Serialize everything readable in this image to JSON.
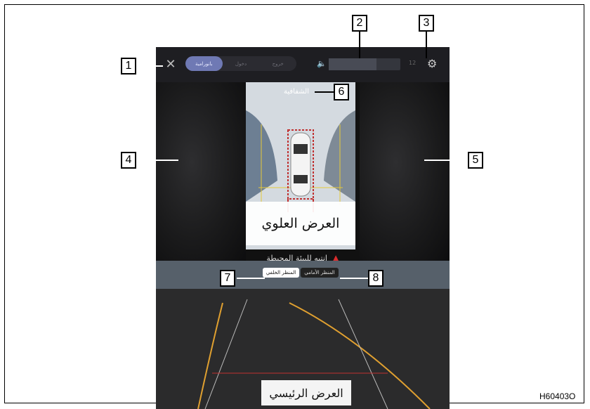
{
  "top_bar": {
    "close_icon": "close-icon",
    "view_tabs": [
      {
        "label": "بانورامية",
        "active": true
      },
      {
        "label": "دخول",
        "active": false
      },
      {
        "label": "خروج",
        "active": false
      }
    ],
    "mute_icon": "speaker-mute-icon",
    "volume_value": "12",
    "volume_fill_fraction": 0.67,
    "settings_icon": "gear-icon"
  },
  "panorama": {
    "transparency_label": "الشفافية",
    "top_view_label": "العرض العلوي",
    "warning_text": "انتبه للبيئة المحيطة"
  },
  "main_view": {
    "rear_tab": "المنظر الخلفي",
    "front_tab": "المنظر الأمامي",
    "label": "العرض الرئيسي"
  },
  "callouts": [
    "1",
    "2",
    "3",
    "4",
    "5",
    "6",
    "7",
    "8"
  ],
  "figure_code": "H60403O"
}
